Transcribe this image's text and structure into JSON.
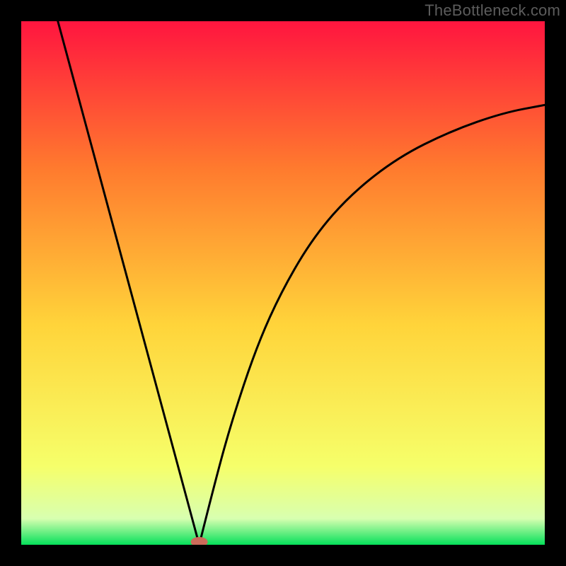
{
  "watermark": "TheBottleneck.com",
  "colors": {
    "frame": "#000000",
    "gradient_top": "#ff153f",
    "gradient_mid_upper": "#ff7a2e",
    "gradient_mid": "#ffd43a",
    "gradient_lower": "#f6ff6a",
    "gradient_lowish": "#d8ffb0",
    "gradient_bottom": "#05e05a",
    "curve": "#000000",
    "marker": "#cc6b5a",
    "watermark_text": "#5c5c5c"
  },
  "chart_data": {
    "type": "line",
    "title": "",
    "xlabel": "",
    "ylabel": "",
    "xlim": [
      0,
      100
    ],
    "ylim": [
      0,
      100
    ],
    "left_branch": [
      {
        "x": 7,
        "y": 100
      },
      {
        "x": 34,
        "y": 0
      }
    ],
    "right_branch": [
      {
        "x": 34,
        "y": 0
      },
      {
        "x": 36.5,
        "y": 10
      },
      {
        "x": 40,
        "y": 23
      },
      {
        "x": 45,
        "y": 38
      },
      {
        "x": 50,
        "y": 49
      },
      {
        "x": 56,
        "y": 59
      },
      {
        "x": 63,
        "y": 67
      },
      {
        "x": 72,
        "y": 74
      },
      {
        "x": 82,
        "y": 79
      },
      {
        "x": 92,
        "y": 82.5
      },
      {
        "x": 100,
        "y": 84
      }
    ],
    "marker": {
      "x": 34,
      "y": 0
    }
  }
}
